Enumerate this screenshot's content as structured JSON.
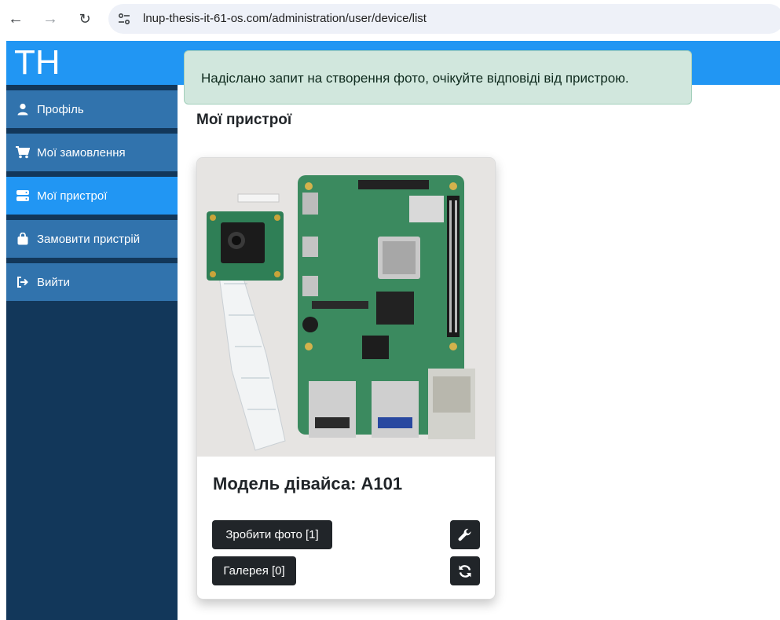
{
  "browser": {
    "url": "lnup-thesis-it-61-os.com/administration/user/device/list"
  },
  "sidebar": {
    "brand": "TH",
    "items": [
      {
        "label": "Профіль",
        "icon": "user-icon"
      },
      {
        "label": "Мої замовлення",
        "icon": "cart-icon"
      },
      {
        "label": "Мої пристрої",
        "icon": "server-icon",
        "active": true
      },
      {
        "label": "Замовити пристрій",
        "icon": "shopping-bag-icon"
      },
      {
        "label": "Вийти",
        "icon": "sign-out-icon"
      }
    ]
  },
  "alert": {
    "message": "Надіслано запит на створення фото, очікуйте відповіді від пристрою."
  },
  "page": {
    "title": "Мої пристрої"
  },
  "device_card": {
    "image": "raspberry-pi-with-camera-module-photo",
    "title": "Модель дівайса: A101",
    "take_photo_label": "Зробити фото [1]",
    "gallery_label": "Галерея [0]",
    "settings_icon": "wrench-icon",
    "refresh_icon": "sync-icon"
  },
  "colors": {
    "primary": "#2196f3",
    "sidebar_bg": "#12375a",
    "menu_item": "#3173ad",
    "alert_bg": "#d1e7dd",
    "button_dark": "#212529"
  }
}
